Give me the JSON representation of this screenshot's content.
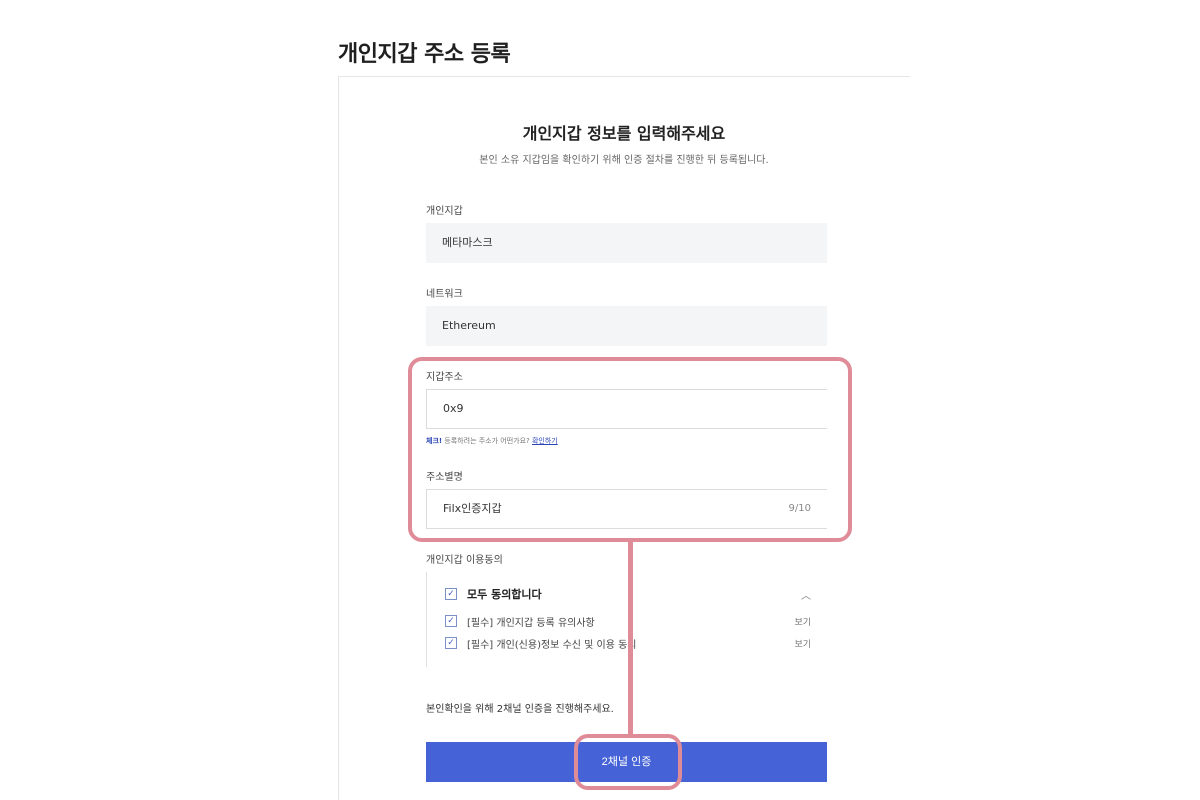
{
  "page": {
    "title": "개인지갑 주소 등록"
  },
  "form": {
    "title": "개인지갑 정보를 입력해주세요",
    "description": "본인 소유 지갑임을 확인하기 위해 인증 절차를 진행한 뒤 등록됩니다.",
    "wallet": {
      "label": "개인지갑",
      "value": "메타마스크"
    },
    "network": {
      "label": "네트워크",
      "value": "Ethereum"
    },
    "address": {
      "label": "지갑주소",
      "value": "0x9"
    },
    "hint": {
      "strong": "체크!",
      "text": " 등록하려는 주소가 어떤가요?",
      "link": "확인하기"
    },
    "alias": {
      "label": "주소별명",
      "value": "Filx인증지갑",
      "counter": "9/10"
    },
    "agreement": {
      "label": "개인지갑 이용동의",
      "all": "모두 동의합니다",
      "items": [
        {
          "text": "[필수] 개인지갑 등록 유의사항",
          "view": "보기"
        },
        {
          "text": "[필수] 개인(신용)정보 수신 및 이용 동의",
          "view": "보기"
        }
      ]
    },
    "notice": "본인확인을 위해 2채널 인증을 진행해주세요.",
    "submit": "2채널 인증"
  },
  "colors": {
    "accent": "#4563d6",
    "highlight": "#e08c98"
  },
  "icons": {
    "check": "checkmark-icon",
    "collapse": "chevron-up-icon"
  }
}
